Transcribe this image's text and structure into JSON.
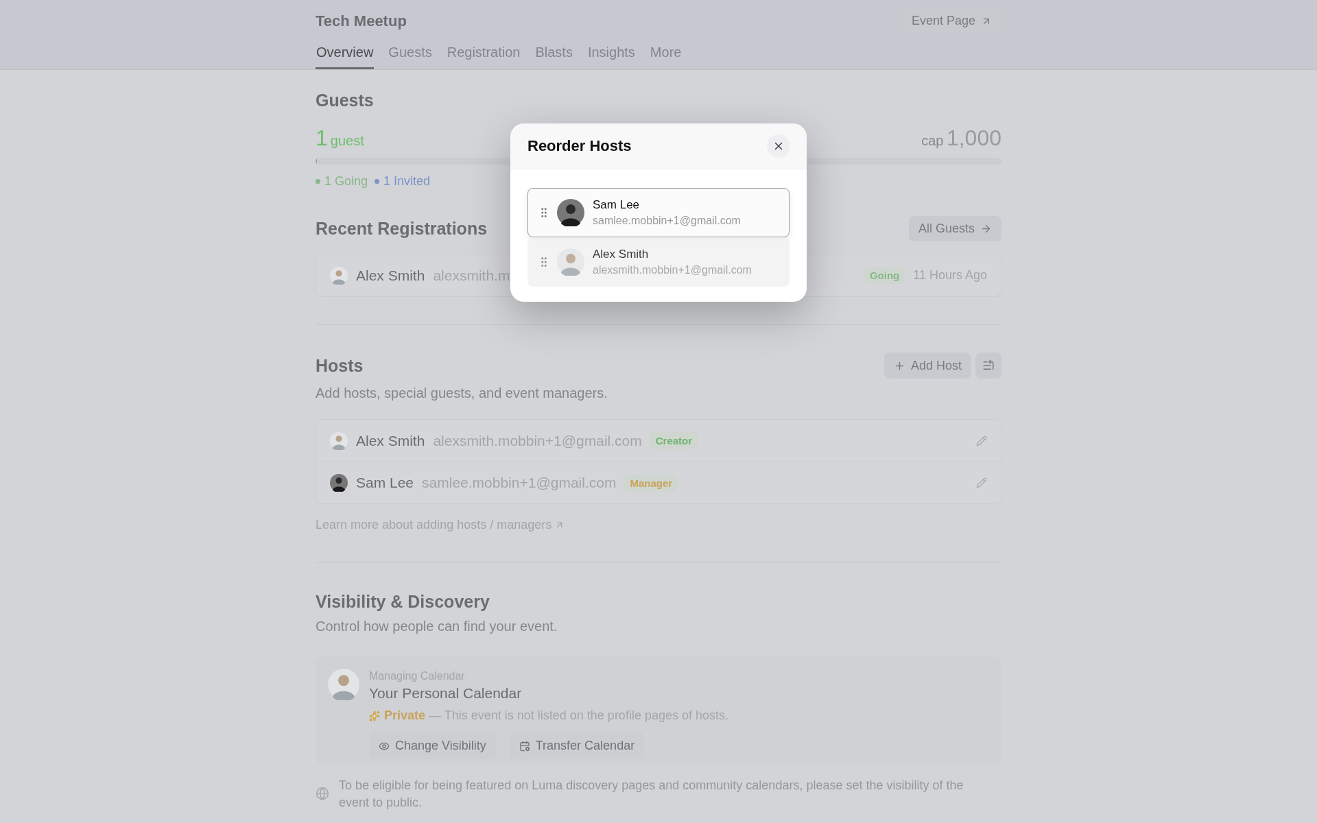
{
  "event": {
    "title": "Tech Meetup",
    "event_page_button": "Event Page"
  },
  "tabs": [
    {
      "label": "Overview",
      "selected": true
    },
    {
      "label": "Guests",
      "selected": false
    },
    {
      "label": "Registration",
      "selected": false
    },
    {
      "label": "Blasts",
      "selected": false
    },
    {
      "label": "Insights",
      "selected": false
    },
    {
      "label": "More",
      "selected": false
    }
  ],
  "guests": {
    "title": "Guests",
    "count": "1",
    "count_unit": "guest",
    "cap_label": "cap",
    "cap": "1,000",
    "level": 0.002,
    "legend": [
      {
        "label": "1 Going",
        "color": "#86b886"
      },
      {
        "label": "1 Invited",
        "color": "#7d93c9"
      }
    ]
  },
  "recent_registrations": {
    "title": "Recent Registrations",
    "all_guests_button": "All Guests",
    "rows": [
      {
        "name": "Alex Smith",
        "email": "alexsmith.m",
        "status": "Going",
        "time": "11 Hours Ago"
      }
    ]
  },
  "hosts": {
    "title": "Hosts",
    "subtitle": "Add hosts, special guests, and event managers.",
    "add_button": "Add Host",
    "rows": [
      {
        "name": "Alex Smith",
        "email": "alexsmith.mobbin+1@gmail.com",
        "role": "Creator",
        "color": "#6fb36f"
      },
      {
        "name": "Sam Lee",
        "email": "samlee.mobbin+1@gmail.com",
        "role": "Manager",
        "color": "#c9a35a"
      }
    ],
    "learn_more": "Learn more about adding hosts / managers"
  },
  "visibility": {
    "title": "Visibility & Discovery",
    "subtitle": "Control how people can find your event.",
    "card": {
      "label": "Managing Calendar",
      "calendar": "Your Personal Calendar",
      "privacy": "Private",
      "privacy_note": "— This event is not listed on the profile pages of hosts.",
      "buttons": [
        {
          "label": "Change Visibility",
          "kind": "eye"
        },
        {
          "label": "Transfer Calendar",
          "kind": "calendar"
        }
      ]
    },
    "footnote": "To be eligible for being featured on Luma discovery pages and community calendars, please set the visibility of the event to public."
  },
  "modal": {
    "title": "Reorder Hosts",
    "items": [
      {
        "name": "Sam Lee",
        "email": "samlee.mobbin+1@gmail.com",
        "lifted": true
      },
      {
        "name": "Alex Smith",
        "email": "alexsmith.mobbin+1@gmail.com",
        "lifted": false
      }
    ]
  }
}
